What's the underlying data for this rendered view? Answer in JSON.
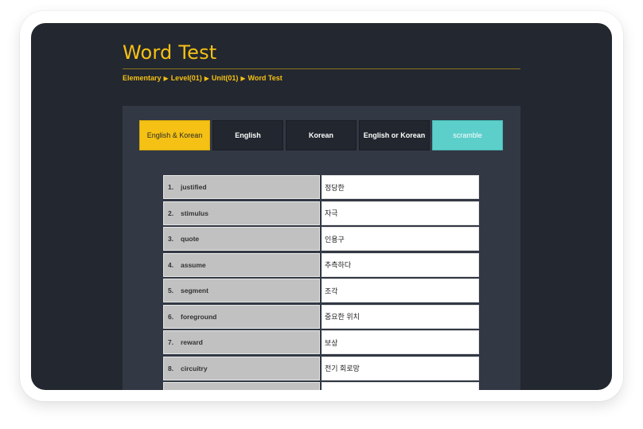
{
  "page": {
    "title": "Word Test",
    "breadcrumb": [
      "Elementary",
      "Level(01)",
      "Unit(01)",
      "Word Test"
    ],
    "crumb_separator": "▶"
  },
  "tabs": [
    {
      "label": "English & Korean",
      "state": "active"
    },
    {
      "label": "English",
      "state": "normal"
    },
    {
      "label": "Korean",
      "state": "normal"
    },
    {
      "label": "English or Korean",
      "state": "normal"
    },
    {
      "label": "scramble",
      "state": "accent"
    }
  ],
  "words": [
    {
      "num": "1.",
      "en": "justified",
      "ko": "정당한"
    },
    {
      "num": "2.",
      "en": "stimulus",
      "ko": "자극"
    },
    {
      "num": "3.",
      "en": "quote",
      "ko": "인용구"
    },
    {
      "num": "4.",
      "en": "assume",
      "ko": "추측하다"
    },
    {
      "num": "5.",
      "en": "segment",
      "ko": "조각"
    },
    {
      "num": "6.",
      "en": "foreground",
      "ko": "중요한 위치"
    },
    {
      "num": "7.",
      "en": "reward",
      "ko": "보상"
    },
    {
      "num": "8.",
      "en": "circuitry",
      "ko": "전기 회로망"
    },
    {
      "num": "",
      "en": "",
      "ko": ""
    }
  ],
  "colors": {
    "accent": "#f4c114",
    "scramble": "#5ccfcb",
    "background": "#23272f",
    "panel": "#323844"
  }
}
